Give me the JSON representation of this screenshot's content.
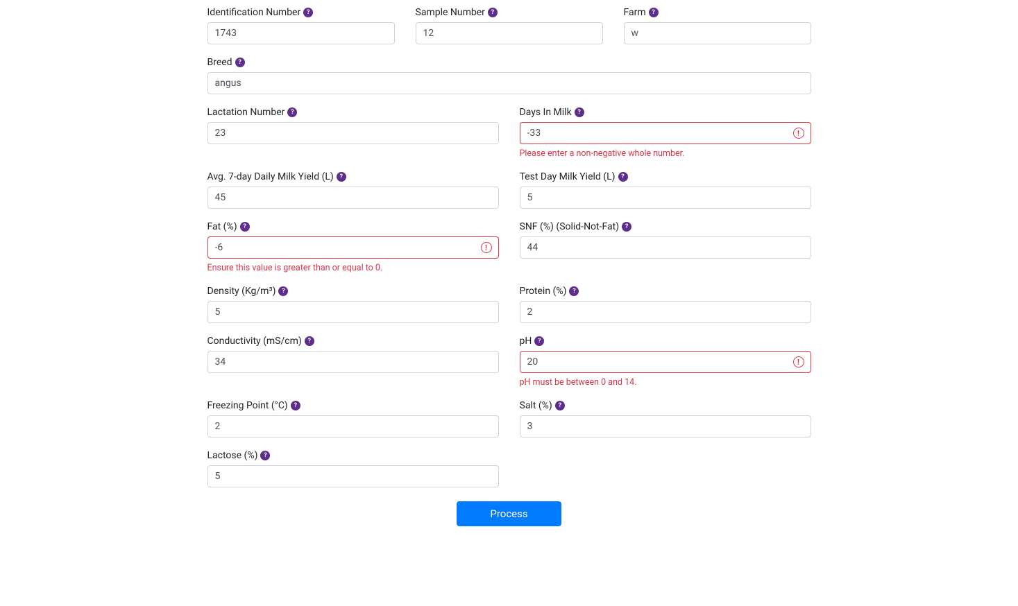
{
  "fields": {
    "identification_number": {
      "label": "Identification Number",
      "value": "1743"
    },
    "sample_number": {
      "label": "Sample Number",
      "value": "12"
    },
    "farm": {
      "label": "Farm",
      "value": "w"
    },
    "breed": {
      "label": "Breed",
      "value": "angus"
    },
    "lactation_number": {
      "label": "Lactation Number",
      "value": "23"
    },
    "days_in_milk": {
      "label": "Days In Milk",
      "value": "-33",
      "error": "Please enter a non-negative whole number."
    },
    "avg_7day_yield": {
      "label": "Avg. 7-day Daily Milk Yield (L)",
      "value": "45"
    },
    "test_day_yield": {
      "label": "Test Day Milk Yield (L)",
      "value": "5"
    },
    "fat": {
      "label": "Fat (%)",
      "value": "-6",
      "error": "Ensure this value is greater than or equal to 0."
    },
    "snf": {
      "label": "SNF (%) (Solid-Not-Fat)",
      "value": "44"
    },
    "density": {
      "label_html": "Density (Kg/m³)",
      "value": "5"
    },
    "protein": {
      "label": "Protein (%)",
      "value": "2"
    },
    "conductivity": {
      "label": "Conductivity (mS/cm)",
      "value": "34"
    },
    "ph": {
      "label": "pH",
      "value": "20",
      "error": "pH must be between 0 and 14."
    },
    "freezing_point": {
      "label_html": "Freezing Point (°C)",
      "value": "2"
    },
    "salt": {
      "label": "Salt (%)",
      "value": "3"
    },
    "lactose": {
      "label": "Lactose (%)",
      "value": "5"
    }
  },
  "buttons": {
    "process": "Process"
  }
}
